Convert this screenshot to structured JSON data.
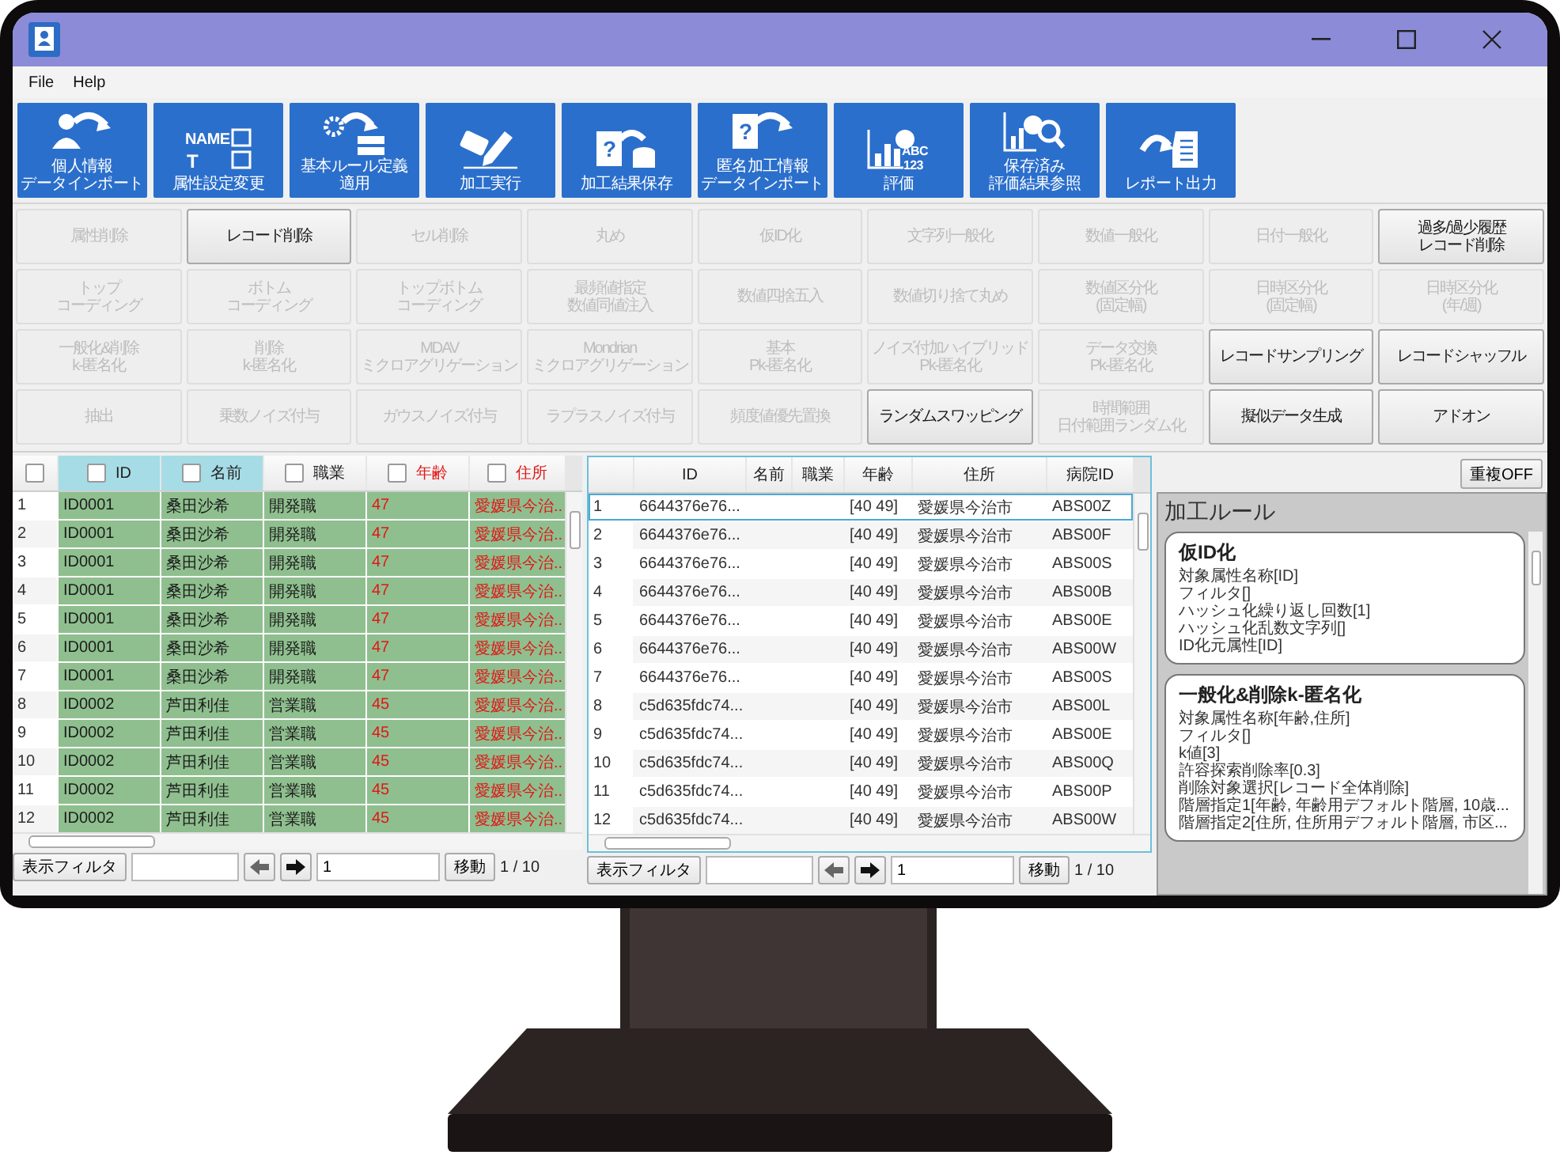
{
  "menu": [
    "File",
    "Help"
  ],
  "toolbar": [
    {
      "lines": [
        "個人情報",
        "データインポート"
      ]
    },
    {
      "lines": [
        "属性設定変更"
      ],
      "icon_text": [
        "NAME",
        "T"
      ]
    },
    {
      "lines": [
        "基本ルール定義",
        "適用"
      ]
    },
    {
      "lines": [
        "加工実行"
      ]
    },
    {
      "lines": [
        "加工結果保存"
      ],
      "icon_text": [
        "?"
      ]
    },
    {
      "lines": [
        "匿名加工情報",
        "データインポート"
      ],
      "icon_text": [
        "?"
      ]
    },
    {
      "lines": [
        "評価"
      ],
      "icon_text": [
        "ABC",
        "123"
      ]
    },
    {
      "lines": [
        "保存済み",
        "評価結果参照"
      ]
    },
    {
      "lines": [
        "レポート出力"
      ]
    }
  ],
  "operations": [
    {
      "lines": [
        "属性削除"
      ],
      "disabled": true
    },
    {
      "lines": [
        "レコード削除"
      ],
      "disabled": false
    },
    {
      "lines": [
        "セル削除"
      ],
      "disabled": true
    },
    {
      "lines": [
        "丸め"
      ],
      "disabled": true
    },
    {
      "lines": [
        "仮ID化"
      ],
      "disabled": true
    },
    {
      "lines": [
        "文字列一般化"
      ],
      "disabled": true
    },
    {
      "lines": [
        "数値一般化"
      ],
      "disabled": true
    },
    {
      "lines": [
        "日付一般化"
      ],
      "disabled": true
    },
    {
      "lines": [
        "過多/過少履歴",
        "レコード削除"
      ],
      "disabled": false
    },
    {
      "lines": [
        "トップ",
        "コーディング"
      ],
      "disabled": true
    },
    {
      "lines": [
        "ボトム",
        "コーディング"
      ],
      "disabled": true
    },
    {
      "lines": [
        "トップボトム",
        "コーディング"
      ],
      "disabled": true
    },
    {
      "lines": [
        "最頻値指定",
        "数値同値注入"
      ],
      "disabled": true
    },
    {
      "lines": [
        "数値四捨五入"
      ],
      "disabled": true
    },
    {
      "lines": [
        "数値切り捨て丸め"
      ],
      "disabled": true
    },
    {
      "lines": [
        "数値区分化",
        "(固定幅)"
      ],
      "disabled": true
    },
    {
      "lines": [
        "日時区分化",
        "(固定幅)"
      ],
      "disabled": true
    },
    {
      "lines": [
        "日時区分化",
        "(年/週)"
      ],
      "disabled": true
    },
    {
      "lines": [
        "一般化&削除",
        "k-匿名化"
      ],
      "disabled": true
    },
    {
      "lines": [
        "削除",
        "k-匿名化"
      ],
      "disabled": true
    },
    {
      "lines": [
        "MDAV",
        "ミクロアグリゲーション"
      ],
      "disabled": true
    },
    {
      "lines": [
        "Mondrian",
        "ミクロアグリゲーション"
      ],
      "disabled": true
    },
    {
      "lines": [
        "基本",
        "Pk-匿名化"
      ],
      "disabled": true
    },
    {
      "lines": [
        "ノイズ付加ハイブリッド",
        "Pk-匿名化"
      ],
      "disabled": true
    },
    {
      "lines": [
        "データ交換",
        "Pk-匿名化"
      ],
      "disabled": true
    },
    {
      "lines": [
        "レコードサンプリング"
      ],
      "disabled": false
    },
    {
      "lines": [
        "レコードシャッフル"
      ],
      "disabled": false
    },
    {
      "lines": [
        "抽出"
      ],
      "disabled": true
    },
    {
      "lines": [
        "乗数ノイズ付与"
      ],
      "disabled": true
    },
    {
      "lines": [
        "ガウスノイズ付与"
      ],
      "disabled": true
    },
    {
      "lines": [
        "ラプラスノイズ付与"
      ],
      "disabled": true
    },
    {
      "lines": [
        "頻度値優先置換"
      ],
      "disabled": true
    },
    {
      "lines": [
        "ランダムスワッピング"
      ],
      "disabled": false
    },
    {
      "lines": [
        "時間範囲",
        "日付範囲ランダム化"
      ],
      "disabled": true
    },
    {
      "lines": [
        "擬似データ生成"
      ],
      "disabled": false
    },
    {
      "lines": [
        "アドオン"
      ],
      "disabled": false
    }
  ],
  "left_table": {
    "columns": [
      {
        "kind": "row_number",
        "checked": false
      },
      {
        "kind": "data",
        "label": "ID",
        "checked": false,
        "selected": true,
        "flagged": false
      },
      {
        "kind": "data",
        "label": "名前",
        "checked": false,
        "selected": true,
        "flagged": false
      },
      {
        "kind": "data",
        "label": "職業",
        "checked": false,
        "selected": false,
        "flagged": false
      },
      {
        "kind": "data",
        "label": "年齢",
        "checked": false,
        "selected": false,
        "flagged": true
      },
      {
        "kind": "data",
        "label": "住所",
        "checked": false,
        "selected": false,
        "flagged": true
      }
    ],
    "rows": [
      {
        "cells": [
          "1",
          "ID0001",
          "桑田沙希",
          "開発職",
          "47",
          "愛媛県今治.."
        ]
      },
      {
        "cells": [
          "2",
          "ID0001",
          "桑田沙希",
          "開発職",
          "47",
          "愛媛県今治.."
        ]
      },
      {
        "cells": [
          "3",
          "ID0001",
          "桑田沙希",
          "開発職",
          "47",
          "愛媛県今治.."
        ]
      },
      {
        "cells": [
          "4",
          "ID0001",
          "桑田沙希",
          "開発職",
          "47",
          "愛媛県今治.."
        ]
      },
      {
        "cells": [
          "5",
          "ID0001",
          "桑田沙希",
          "開発職",
          "47",
          "愛媛県今治.."
        ]
      },
      {
        "cells": [
          "6",
          "ID0001",
          "桑田沙希",
          "開発職",
          "47",
          "愛媛県今治.."
        ]
      },
      {
        "cells": [
          "7",
          "ID0001",
          "桑田沙希",
          "開発職",
          "47",
          "愛媛県今治.."
        ]
      },
      {
        "cells": [
          "8",
          "ID0002",
          "芦田利佳",
          "営業職",
          "45",
          "愛媛県今治.."
        ]
      },
      {
        "cells": [
          "9",
          "ID0002",
          "芦田利佳",
          "営業職",
          "45",
          "愛媛県今治.."
        ]
      },
      {
        "cells": [
          "10",
          "ID0002",
          "芦田利佳",
          "営業職",
          "45",
          "愛媛県今治.."
        ]
      },
      {
        "cells": [
          "11",
          "ID0002",
          "芦田利佳",
          "営業職",
          "45",
          "愛媛県今治.."
        ]
      },
      {
        "cells": [
          "12",
          "ID0002",
          "芦田利佳",
          "営業職",
          "45",
          "愛媛県今治.."
        ]
      }
    ],
    "footer": {
      "filter_button": "表示フィルタ",
      "page": "1",
      "go_button": "移動",
      "page_count": "1 / 10"
    }
  },
  "right_table": {
    "columns": [
      {
        "kind": "row_number"
      },
      {
        "kind": "data",
        "label": "ID"
      },
      {
        "kind": "data",
        "label": "名前"
      },
      {
        "kind": "data",
        "label": "職業"
      },
      {
        "kind": "data",
        "label": "年齢"
      },
      {
        "kind": "data",
        "label": "住所"
      },
      {
        "kind": "data",
        "label": "病院ID"
      }
    ],
    "rows": [
      {
        "cells": [
          "1",
          "6644376e76...",
          null,
          null,
          "[40 49]",
          "愛媛県今治市",
          "ABS00Z"
        ],
        "selected": true
      },
      {
        "cells": [
          "2",
          "6644376e76...",
          null,
          null,
          "[40 49]",
          "愛媛県今治市",
          "ABS00F"
        ],
        "selected": false
      },
      {
        "cells": [
          "3",
          "6644376e76...",
          null,
          null,
          "[40 49]",
          "愛媛県今治市",
          "ABS00S"
        ],
        "selected": false
      },
      {
        "cells": [
          "4",
          "6644376e76...",
          null,
          null,
          "[40 49]",
          "愛媛県今治市",
          "ABS00B"
        ],
        "selected": false
      },
      {
        "cells": [
          "5",
          "6644376e76...",
          null,
          null,
          "[40 49]",
          "愛媛県今治市",
          "ABS00E"
        ],
        "selected": false
      },
      {
        "cells": [
          "6",
          "6644376e76...",
          null,
          null,
          "[40 49]",
          "愛媛県今治市",
          "ABS00W"
        ],
        "selected": false
      },
      {
        "cells": [
          "7",
          "6644376e76...",
          null,
          null,
          "[40 49]",
          "愛媛県今治市",
          "ABS00S"
        ],
        "selected": false
      },
      {
        "cells": [
          "8",
          "c5d635fdc74...",
          null,
          null,
          "[40 49]",
          "愛媛県今治市",
          "ABS00L"
        ],
        "selected": false
      },
      {
        "cells": [
          "9",
          "c5d635fdc74...",
          null,
          null,
          "[40 49]",
          "愛媛県今治市",
          "ABS00E"
        ],
        "selected": false
      },
      {
        "cells": [
          "10",
          "c5d635fdc74...",
          null,
          null,
          "[40 49]",
          "愛媛県今治市",
          "ABS00Q"
        ],
        "selected": false
      },
      {
        "cells": [
          "11",
          "c5d635fdc74...",
          null,
          null,
          "[40 49]",
          "愛媛県今治市",
          "ABS00P"
        ],
        "selected": false
      },
      {
        "cells": [
          "12",
          "c5d635fdc74...",
          null,
          null,
          "[40 49]",
          "愛媛県今治市",
          "ABS00W"
        ],
        "selected": false
      }
    ],
    "footer": {
      "filter_button": "表示フィルタ",
      "page": "1",
      "go_button": "移動",
      "page_count": "1 / 10"
    }
  },
  "rule_panel": {
    "toggle_button": "重複OFF",
    "title": "加工ルール",
    "rules": [
      {
        "title": "仮ID化",
        "lines": [
          "対象属性名称[ID]",
          "フィルタ[]",
          "ハッシュ化繰り返し回数[1]",
          "ハッシュ化乱数文字列[]",
          "ID化元属性[ID]"
        ]
      },
      {
        "title": "一般化&削除k-匿名化",
        "lines": [
          "対象属性名称[年齢,住所]",
          "フィルタ[]",
          "k値[3]",
          "許容探索削除率[0.3]",
          "削除対象選択[レコード全体削除]",
          "階層指定1[年齢, 年齢用デフォルト階層, 10歳...",
          "階層指定2[住所, 住所用デフォルト階層, 市区..."
        ]
      }
    ]
  }
}
